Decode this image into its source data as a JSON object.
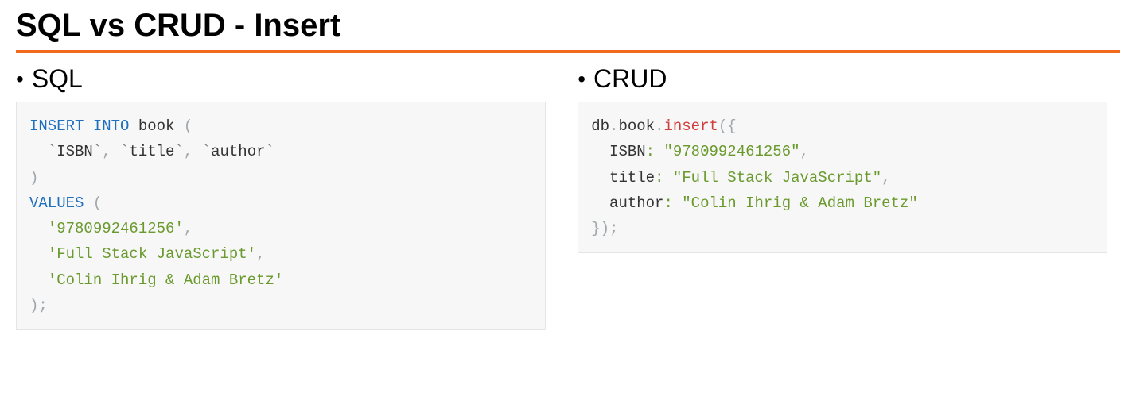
{
  "header": {
    "title": "SQL vs CRUD - Insert"
  },
  "left": {
    "label": "SQL",
    "code": {
      "kw_insert": "INSERT",
      "kw_into": "INTO",
      "table": "book",
      "cols": {
        "isbn": "ISBN",
        "title": "title",
        "author": "author"
      },
      "kw_values": "VALUES",
      "vals": {
        "isbn": "'9780992461256'",
        "title": "'Full Stack JavaScript'",
        "author": "'Colin Ihrig & Adam Bretz'"
      }
    }
  },
  "right": {
    "label": "CRUD",
    "code": {
      "db": "db",
      "coll": "book",
      "method": "insert",
      "fields": {
        "isbn_key": "ISBN",
        "isbn_val": "\"9780992461256\"",
        "title_key": "title",
        "title_val": "\"Full Stack JavaScript\"",
        "author_key": "author",
        "author_val": "\"Colin Ihrig & Adam Bretz\""
      }
    }
  }
}
